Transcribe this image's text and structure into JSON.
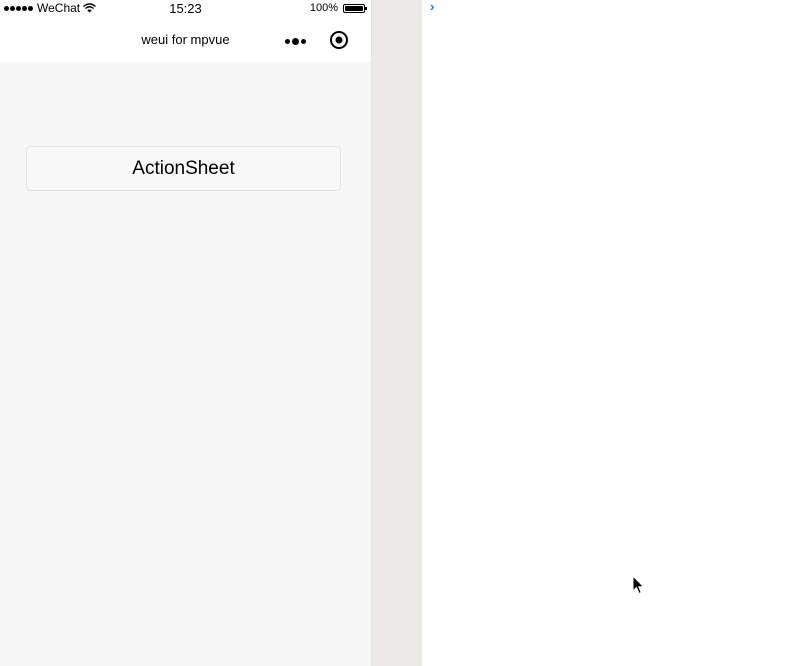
{
  "status_bar": {
    "carrier": "WeChat",
    "time": "15:23",
    "battery": "100%"
  },
  "nav": {
    "title": "weui for mpvue",
    "menu_icon": "more-dots-icon",
    "close_icon": "capsule-close-icon"
  },
  "page": {
    "button_label": "ActionSheet"
  },
  "console": {
    "prompt": "›"
  },
  "colors": {
    "page_background": "#f7f7f7",
    "gutter": "#eceae7",
    "console_prompt": "#1a73e8"
  }
}
